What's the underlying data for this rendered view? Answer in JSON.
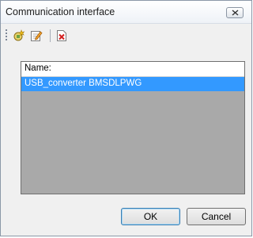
{
  "window": {
    "title": "Communication interface"
  },
  "toolbar": {
    "items": [
      {
        "icon": "add-connection-icon"
      },
      {
        "icon": "edit-icon"
      },
      {
        "icon": "delete-icon"
      }
    ]
  },
  "list": {
    "columns": [
      "Name:"
    ],
    "rows": [
      {
        "name": "USB_converter BMSDLPWG",
        "selected": true
      }
    ]
  },
  "buttons": {
    "ok_label": "OK",
    "cancel_label": "Cancel"
  },
  "colors": {
    "selection": "#3399ff",
    "list_background": "#a9a9a9",
    "dialog_background": "#f0f0f0"
  }
}
